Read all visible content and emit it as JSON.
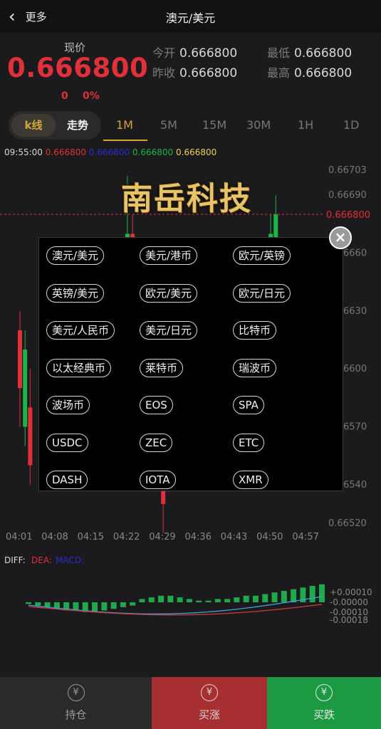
{
  "header": {
    "back_label": "更多",
    "title": "澳元/美元",
    "back_icon": "chevron-left-icon"
  },
  "quote": {
    "label": "现价",
    "price": "0.666800",
    "change": "0",
    "change_pct": "0%",
    "stats": [
      {
        "key": "今开",
        "value": "0.666800"
      },
      {
        "key": "最低",
        "value": "0.666800"
      },
      {
        "key": "昨收",
        "value": "0.666800"
      },
      {
        "key": "最高",
        "value": "0.666800"
      }
    ]
  },
  "tabs": {
    "segment": [
      "k线",
      "走势"
    ],
    "active_segment": "k线",
    "timeframes": [
      "1M",
      "5M",
      "15M",
      "30M",
      "1H",
      "1D"
    ],
    "active_timeframe": "1M"
  },
  "chart": {
    "time": "09:55:00",
    "ohlc": [
      "0.666800",
      "0.666800",
      "0.666800",
      "0.666800"
    ],
    "ohlc_colors": [
      "#e0303a",
      "#2a2ad0",
      "#19b548",
      "#e8d25a"
    ],
    "price_marker": "0.666800",
    "logo_text": "南岳科技"
  },
  "chart_data": [
    {
      "type": "bar",
      "title": "",
      "x": [
        "04:01",
        "04:08",
        "04:15",
        "04:22",
        "04:29",
        "04:36",
        "04:43",
        "04:50",
        "04:57"
      ],
      "y_tick_labels": [
        "0.66703",
        "0.66690",
        "6660",
        "6630",
        "6600",
        "6570",
        "6540",
        "0.66520"
      ],
      "last_price": "0.666800",
      "series": [
        {
          "name": "bull",
          "color": "#19b548"
        },
        {
          "name": "bear",
          "color": "#e0303a"
        }
      ],
      "candles": [
        {
          "x": "04:01",
          "open": 0.6662,
          "close": 0.6659,
          "high": 0.6663,
          "low": 0.6657
        },
        {
          "x": "04:02",
          "open": 0.6657,
          "close": 0.6661,
          "high": 0.6662,
          "low": 0.6656
        },
        {
          "x": "04:03",
          "open": 0.6658,
          "close": 0.6655,
          "high": 0.666,
          "low": 0.6654
        },
        {
          "x": "04:22",
          "open": 0.6664,
          "close": 0.6667,
          "high": 0.667,
          "low": 0.6663
        },
        {
          "x": "04:23",
          "open": 0.6667,
          "close": 0.6665,
          "high": 0.6668,
          "low": 0.6663
        },
        {
          "x": "04:29",
          "open": 0.6655,
          "close": 0.6653,
          "high": 0.6656,
          "low": 0.66515
        },
        {
          "x": "04:50",
          "open": 0.6665,
          "close": 0.6667,
          "high": 0.6668,
          "low": 0.6664
        },
        {
          "x": "04:51",
          "open": 0.6666,
          "close": 0.6668,
          "high": 0.6669,
          "low": 0.6665
        }
      ]
    },
    {
      "type": "bar",
      "title": "",
      "y_tick_labels": [
        "+0.00010",
        "-0.00000",
        "-0.00010",
        "-0.00018"
      ],
      "legend": [
        "DIFF:",
        "DEA:",
        "MACD:"
      ],
      "series": [
        {
          "name": "MACD",
          "values": [
            -1e-05,
            -2e-05,
            -3e-05,
            -4e-05,
            -5e-05,
            -5e-05,
            -6e-05,
            -6e-05,
            -5e-05,
            -4e-05,
            -3e-05,
            -2e-05,
            2e-05,
            3e-05,
            4e-05,
            4e-05,
            3e-05,
            2e-05,
            1e-05,
            1e-05,
            2e-05,
            2e-05,
            3e-05,
            4e-05,
            4e-05,
            5e-05,
            6e-05,
            7e-05,
            8e-05,
            9e-05,
            0.0001,
            0.00011
          ]
        }
      ]
    }
  ],
  "symbol_picker": {
    "close_icon": "close-circle-icon",
    "symbols": [
      "澳元/美元",
      "美元/港币",
      "欧元/英镑",
      "英镑/美元",
      "欧元/美元",
      "欧元/日元",
      "美元/人民币",
      "美元/日元",
      "比特币",
      "以太经典币",
      "莱特币",
      "瑞波币",
      "波场币",
      "EOS",
      "SPA",
      "USDC",
      "ZEC",
      "ETC",
      "DASH",
      "IOTA",
      "XMR"
    ]
  },
  "bottom_bar": {
    "items": [
      {
        "label": "持仓",
        "icon": "position-icon",
        "bg": "#2a2a2c",
        "color": "#9a9a9a"
      },
      {
        "label": "买涨",
        "icon": "buy-up-icon",
        "bg": "#a72f32",
        "color": "#d6d6d6"
      },
      {
        "label": "买跌",
        "icon": "buy-down-icon",
        "bg": "#1b9a42",
        "color": "#e8e8e8"
      }
    ]
  }
}
